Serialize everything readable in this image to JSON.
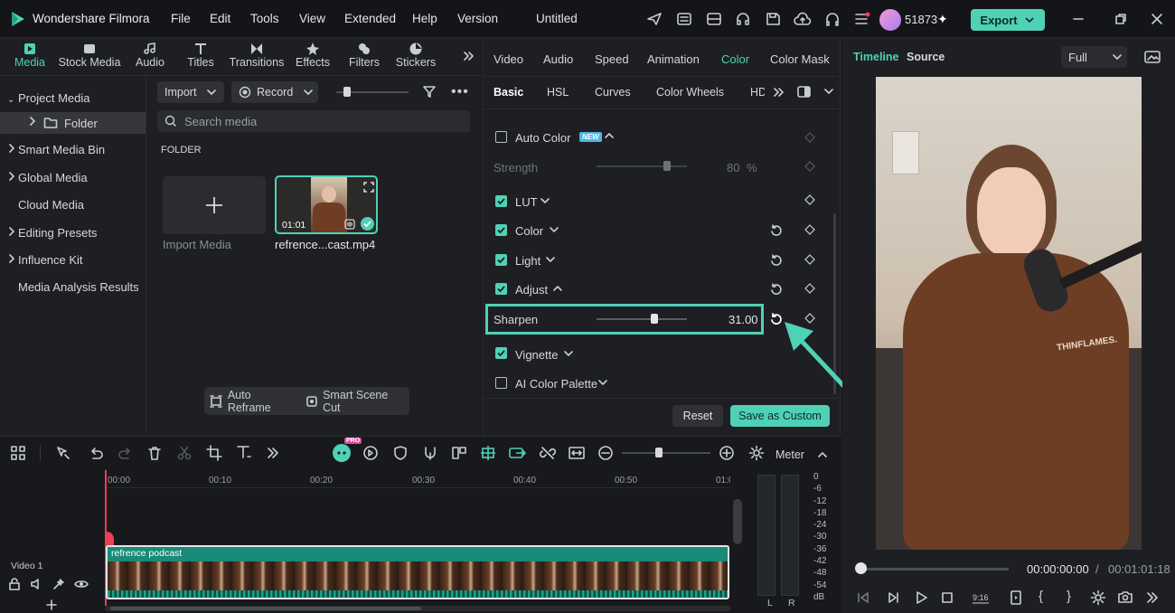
{
  "app": {
    "name": "Wondershare Filmora",
    "project_title": "Untitled",
    "credits": "51873",
    "export_label": "Export"
  },
  "menu": [
    "File",
    "Edit",
    "Tools",
    "View",
    "Extended",
    "Help",
    "Version"
  ],
  "media_tabs": [
    "Media",
    "Stock Media",
    "Audio",
    "Titles",
    "Transitions",
    "Effects",
    "Filters",
    "Stickers"
  ],
  "sidebar": [
    {
      "label": "Project Media"
    },
    {
      "label": "Folder"
    },
    {
      "label": "Smart Media Bin"
    },
    {
      "label": "Global Media"
    },
    {
      "label": "Cloud Media"
    },
    {
      "label": "Editing Presets"
    },
    {
      "label": "Influence Kit"
    },
    {
      "label": "Media Analysis Results"
    }
  ],
  "media_toolbar": {
    "import": "Import",
    "record": "Record",
    "search_placeholder": "Search media",
    "folder_heading": "FOLDER"
  },
  "media_items": {
    "import_label": "Import Media",
    "clip_name": "refrence...cast.mp4",
    "clip_duration": "01:01"
  },
  "media_bottom": {
    "auto_reframe": "Auto Reframe",
    "smart_scene_cut": "Smart Scene Cut"
  },
  "props_tabs": [
    "Video",
    "Audio",
    "Speed",
    "Animation",
    "Color",
    "Color Mask"
  ],
  "color_subtabs": [
    "Basic",
    "HSL",
    "Curves",
    "Color Wheels",
    "HD"
  ],
  "color_rows": {
    "auto_color": "Auto Color",
    "new_badge": "NEW",
    "strength": "Strength",
    "strength_value": "80",
    "strength_unit": "%",
    "lut": "LUT",
    "color": "Color",
    "light": "Light",
    "adjust": "Adjust",
    "sharpen": "Sharpen",
    "sharpen_value": "31.00",
    "vignette": "Vignette",
    "ai_palette": "AI Color Palette"
  },
  "props_footer": {
    "reset": "Reset",
    "save_custom": "Save as Custom"
  },
  "preview": {
    "tab_timeline": "Timeline",
    "tab_source": "Source",
    "quality": "Full",
    "current_time": "00:00:00:00",
    "separator": "/",
    "total_time": "00:01:01:18",
    "hoodie_text": "THINFLAMES."
  },
  "timeline": {
    "ruler": [
      "00:00",
      "00:10",
      "00:20",
      "00:30",
      "00:40",
      "00:50",
      "01:0"
    ],
    "track_label": "Video 1",
    "clip_label": "refrence podcast",
    "meter_label": "Meter",
    "meter_scale": [
      "0",
      "-6",
      "-12",
      "-18",
      "-24",
      "-30",
      "-36",
      "-42",
      "-48",
      "-54",
      "dB"
    ],
    "meter_lr": [
      "L",
      "R"
    ],
    "pro_badge": "PRO"
  },
  "colors": {
    "accent": "#4fd1b6",
    "bg": "#1b1c1f",
    "panel": "#1e1f23",
    "playhead": "#ef3d58"
  }
}
